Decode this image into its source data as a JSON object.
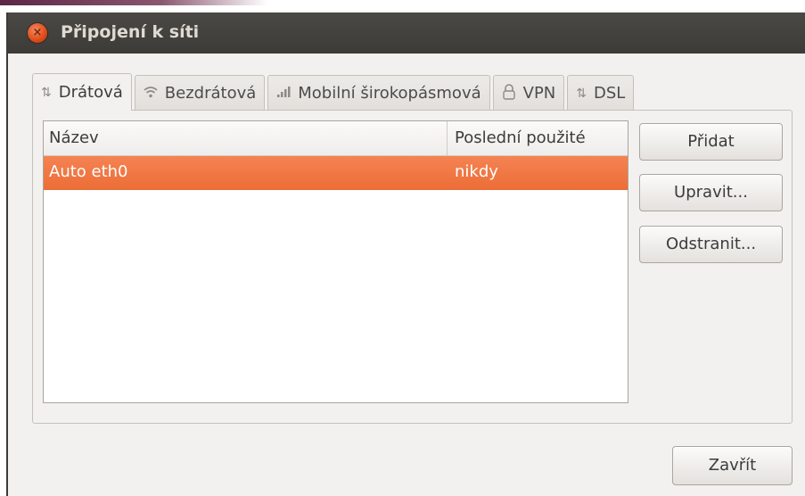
{
  "window": {
    "title": "Připojení k síti",
    "close_glyph": "×"
  },
  "tabs": [
    {
      "label": "Drátová",
      "icon": "wired-network-icon",
      "active": true
    },
    {
      "label": "Bezdrátová",
      "icon": "wireless-network-icon",
      "active": false
    },
    {
      "label": "Mobilní širokopásmová",
      "icon": "mobile-broadband-icon",
      "active": false
    },
    {
      "label": "VPN",
      "icon": "vpn-lock-icon",
      "active": false
    },
    {
      "label": "DSL",
      "icon": "dsl-network-icon",
      "active": false
    }
  ],
  "list": {
    "columns": [
      "Název",
      "Poslední použité"
    ],
    "rows": [
      {
        "name": "Auto eth0",
        "last_used": "nikdy",
        "selected": true
      }
    ]
  },
  "buttons": {
    "add": "Přidat",
    "edit": "Upravit...",
    "remove": "Odstranit...",
    "close": "Zavřít"
  },
  "colors": {
    "titlebar": "#3c3b37",
    "selection": "#f07746",
    "window_bg": "#f2f1f0"
  }
}
